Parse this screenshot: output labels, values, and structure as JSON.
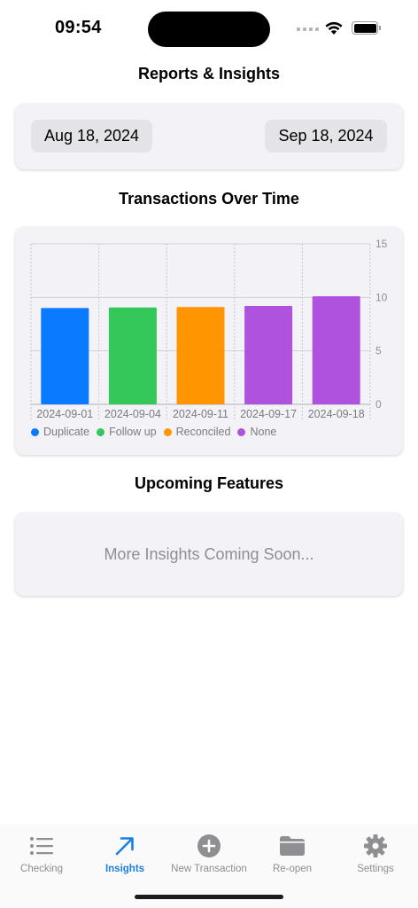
{
  "status_bar": {
    "time": "09:54"
  },
  "page_title": "Reports & Insights",
  "date_range": {
    "start": "Aug 18, 2024",
    "end": "Sep 18, 2024"
  },
  "chart_section_title": "Transactions Over Time",
  "chart_data": {
    "type": "bar",
    "categories": [
      "2024-09-01",
      "2024-09-04",
      "2024-09-11",
      "2024-09-17",
      "2024-09-18"
    ],
    "values": [
      9,
      9.05,
      9.1,
      9.2,
      10.1
    ],
    "colors": [
      "#0a7aff",
      "#34c759",
      "#ff9500",
      "#af52de",
      "#af52de"
    ],
    "y_ticks": [
      0,
      5,
      10,
      15
    ],
    "ylim": [
      0,
      15
    ],
    "grid": true,
    "legend": [
      {
        "label": "Duplicate",
        "color": "#0a7aff"
      },
      {
        "label": "Follow up",
        "color": "#34c759"
      },
      {
        "label": "Reconciled",
        "color": "#ff9500"
      },
      {
        "label": "None",
        "color": "#af52de"
      }
    ],
    "legend_position": "bottom-left"
  },
  "upcoming_section_title": "Upcoming Features",
  "upcoming_message": "More Insights Coming Soon...",
  "tabs": [
    {
      "label": "Checking",
      "icon": "list-icon"
    },
    {
      "label": "Insights",
      "icon": "arrow-up-right-icon"
    },
    {
      "label": "New Transaction",
      "icon": "plus-circle-icon"
    },
    {
      "label": "Re-open",
      "icon": "folder-icon"
    },
    {
      "label": "Settings",
      "icon": "gear-icon"
    }
  ],
  "accent_color": "#1a7fe5"
}
